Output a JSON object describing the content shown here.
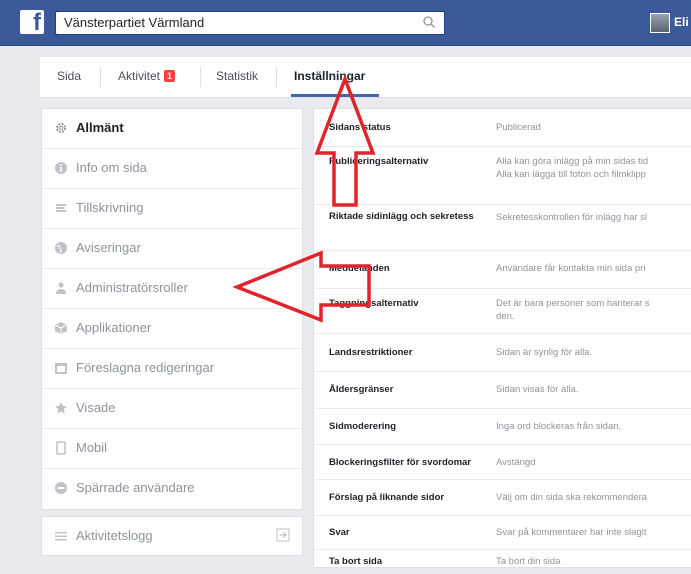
{
  "topbar": {
    "search_value": "Vänsterpartiet Värmland",
    "user_name": "Eli"
  },
  "tabs": [
    {
      "label": "Sida"
    },
    {
      "label": "Aktivitet",
      "badge": "1"
    },
    {
      "label": "Statistik"
    },
    {
      "label": "Inställningar",
      "active": true
    }
  ],
  "sidebar": {
    "items": [
      {
        "label": "Allmänt",
        "icon": "gear-icon"
      },
      {
        "label": "Info om sida",
        "icon": "info-icon"
      },
      {
        "label": "Tillskrivning",
        "icon": "flag-icon"
      },
      {
        "label": "Aviseringar",
        "icon": "globe-icon"
      },
      {
        "label": "Administratörsroller",
        "icon": "person-icon"
      },
      {
        "label": "Applikationer",
        "icon": "cube-icon"
      },
      {
        "label": "Föreslagna redigeringar",
        "icon": "calendar-icon"
      },
      {
        "label": "Visade",
        "icon": "star-icon"
      },
      {
        "label": "Mobil",
        "icon": "mobile-icon"
      },
      {
        "label": "Spärrade användare",
        "icon": "block-icon"
      }
    ],
    "log_label": "Aktivitetslogg"
  },
  "settings": [
    {
      "key": "Sidans status",
      "value": "Publicerad"
    },
    {
      "key": "Publiceringsalternativ",
      "value": "Alla kan göra inlägg på min sidas tid",
      "value2": "Alla kan lägga till foton och filmklipp"
    },
    {
      "key": "Riktade sidinlägg och sekretess",
      "value": "Sekretesskontrollen för inlägg har sl"
    },
    {
      "key": "Meddelanden",
      "value": "Användare får kontakta min sida pri"
    },
    {
      "key": "Taggningsalternativ",
      "value": "Det är bara personer som hanterar s",
      "value2": "den."
    },
    {
      "key": "Landsrestriktioner",
      "value": "Sidan är synlig för alla."
    },
    {
      "key": "Åldersgränser",
      "value": "Sidan visas för alla."
    },
    {
      "key": "Sidmoderering",
      "value": "Inga ord blockeras från sidan."
    },
    {
      "key": "Blockeringsfilter för svordomar",
      "value": "Avstängd"
    },
    {
      "key": "Förslag på liknande sidor",
      "value": "Välj om din sida ska rekommendera"
    },
    {
      "key": "Svar",
      "value": "Svar på kommentarer har inte slagit"
    },
    {
      "key": "Ta bort sida",
      "value": "Ta bort din sida"
    }
  ],
  "colors": {
    "brand": "#3b5998",
    "badge": "#fa3e3e",
    "annotation_arrow": "#e0242b"
  }
}
